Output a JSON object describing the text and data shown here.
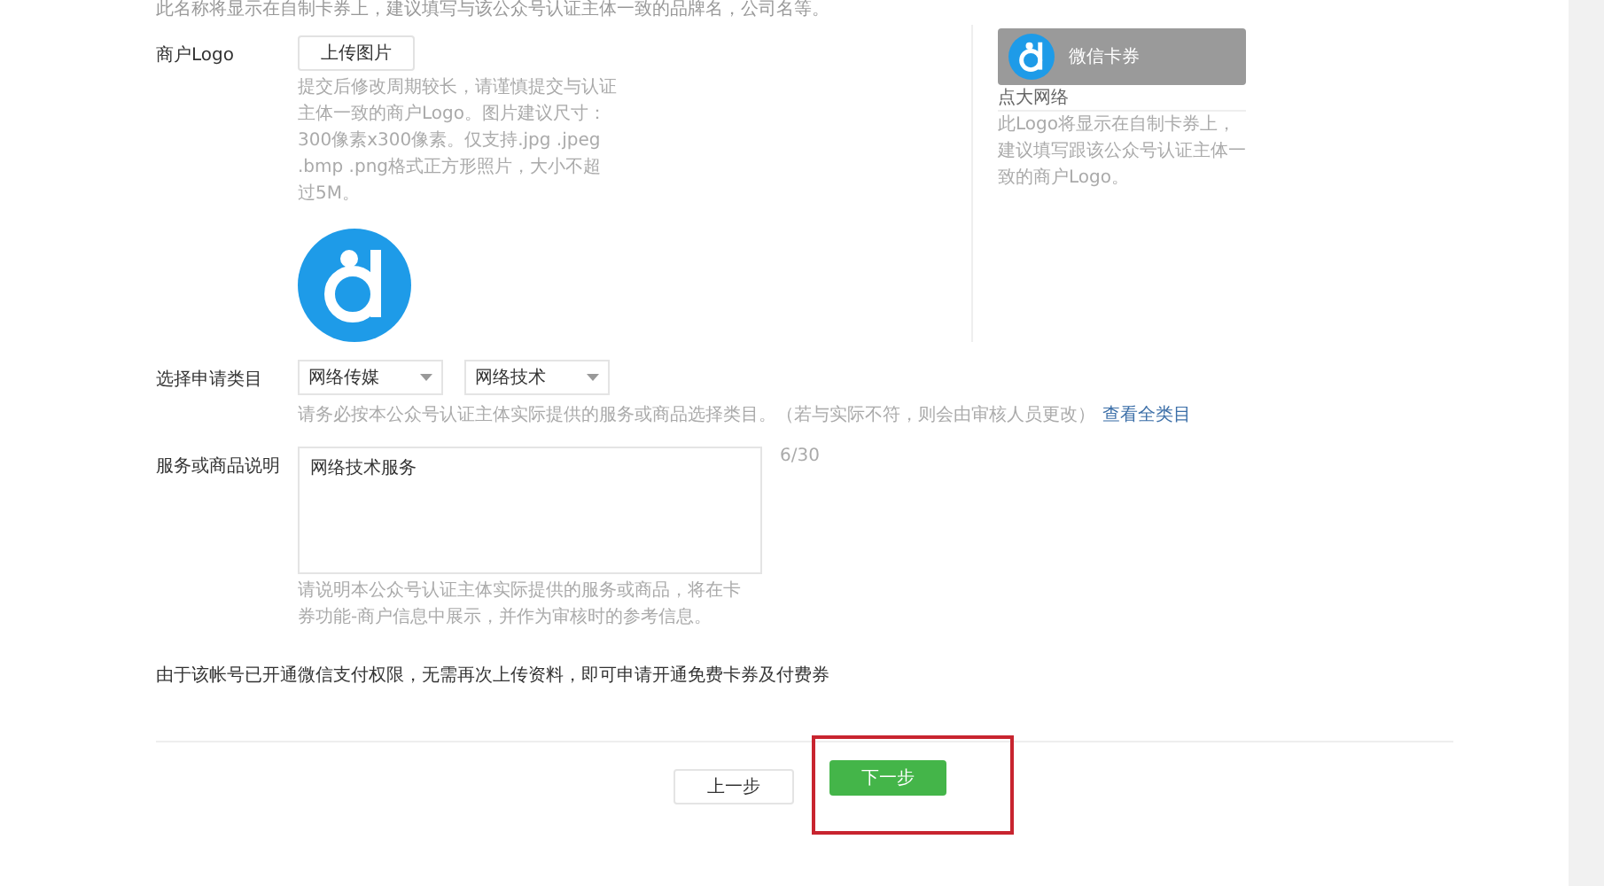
{
  "top_hint": "此名称将显示在自制卡券上，建议填写与该公众号认证主体一致的品牌名，公司名等。",
  "logo_section": {
    "label": "商户Logo",
    "upload_button": "上传图片",
    "hint": "提交后修改周期较长，请谨慎提交与认证主体一致的商户Logo。图片建议尺寸：300像素x300像素。仅支持.jpg .jpeg .bmp .png格式正方形照片，大小不超过5M。",
    "preview": {
      "header": "微信卡券",
      "name": "点大网络",
      "hint": "此Logo将显示在自制卡券上，建议填写跟该公众号认证主体一致的商户Logo。"
    }
  },
  "category_section": {
    "label": "选择申请类目",
    "selects": [
      {
        "value": "网络传媒"
      },
      {
        "value": "网络技术"
      }
    ],
    "hint": "请务必按本公众号认证主体实际提供的服务或商品选择类目。（若与实际不符，则会由审核人员更改）",
    "link": "查看全类目"
  },
  "description_section": {
    "label": "服务或商品说明",
    "value": "网络技术服务",
    "counter": "6/30",
    "hint": "请说明本公众号认证主体实际提供的服务或商品，将在卡券功能-商户信息中展示，并作为审核时的参考信息。"
  },
  "notice": "由于该帐号已开通微信支付权限，无需再次上传资料，即可申请开通免费卡券及付费券",
  "buttons": [
    {
      "label": "上一步",
      "kind": "secondary",
      "highlighted": false
    },
    {
      "label": "下一步",
      "kind": "primary",
      "highlighted": true
    }
  ]
}
